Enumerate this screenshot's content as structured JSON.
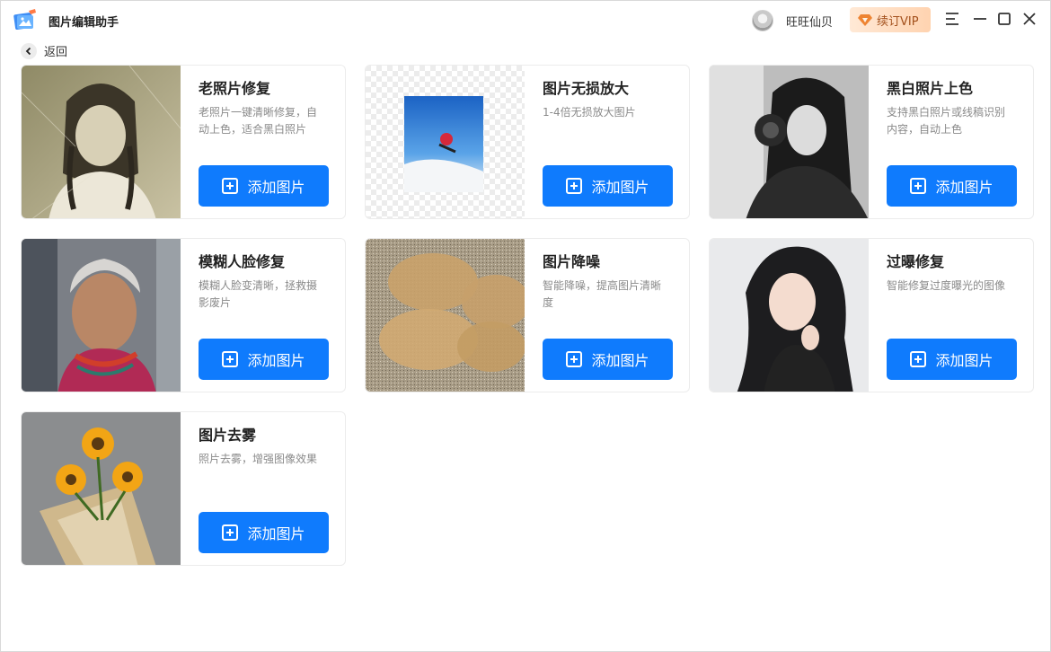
{
  "app": {
    "title": "图片编辑助手"
  },
  "user": {
    "name": "旺旺仙贝"
  },
  "vip": {
    "label": "续订VIP"
  },
  "nav": {
    "back_label": "返回"
  },
  "icons": {
    "logo": "app-logo-icon",
    "menu": "menu-icon",
    "minimize": "minimize-icon",
    "maximize": "maximize-icon",
    "close": "close-icon",
    "back": "chevron-left-icon",
    "add": "plus-square-icon"
  },
  "colors": {
    "primary": "#0f7bfd",
    "vip_text": "#a3501c"
  },
  "cards": [
    {
      "title": "老照片修复",
      "desc": "老照片一键清晰修复，自动上色，适合黑白照片",
      "button": "添加图片"
    },
    {
      "title": "图片无损放大",
      "desc": "1-4倍无损放大图片",
      "button": "添加图片"
    },
    {
      "title": "黑白照片上色",
      "desc": "支持黑白照片或线稿识别内容，自动上色",
      "button": "添加图片"
    },
    {
      "title": "模糊人脸修复",
      "desc": "模糊人脸变清晰，拯救摄影废片",
      "button": "添加图片"
    },
    {
      "title": "图片降噪",
      "desc": "智能降噪，提高图片清晰度",
      "button": "添加图片"
    },
    {
      "title": "过曝修复",
      "desc": "智能修复过度曝光的图像",
      "button": "添加图片"
    },
    {
      "title": "图片去雾",
      "desc": "照片去雾，增强图像效果",
      "button": "添加图片"
    }
  ]
}
